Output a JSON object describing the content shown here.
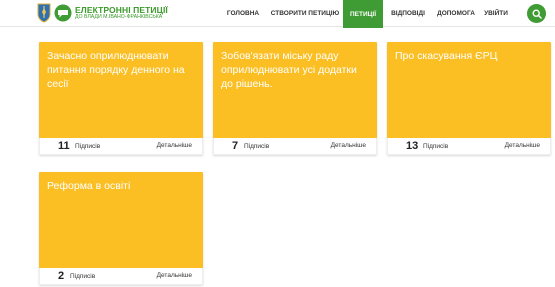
{
  "header": {
    "logo_title": "ЕЛЕКТРОННІ ПЕТИЦІЇ",
    "logo_subtitle": "ДО ВЛАДИ М.ІВАНО-ФРАНКІВСЬКА",
    "nav": [
      "ГОЛОВНА",
      "СТВОРИТИ ПЕТИЦІЮ",
      "ПЕТИЦІЇ",
      "ВІДПОВІДІ",
      "ДОПОМОГА",
      "УВІЙТИ"
    ],
    "active_nav": "ПЕТИЦІЇ",
    "search_icon": "search-icon"
  },
  "petitions": [
    {
      "title": "Зачасно оприлюднювати питання порядку денного на сесії",
      "count": "11",
      "count_label": "Підписів",
      "details": "Детальніше"
    },
    {
      "title": "Зобов'язати міську раду оприлюднювати усі додатки до рішень.",
      "count": "7",
      "count_label": "Підписів",
      "details": "Детальніше"
    },
    {
      "title": "Про скасування ЄРЦ",
      "count": "13",
      "count_label": "Підписів",
      "details": "Детальніше"
    },
    {
      "title": "Реформа в освіті",
      "count": "2",
      "count_label": "Підписів",
      "details": "Детальніше"
    }
  ],
  "colors": {
    "accent_green": "#3f9b33",
    "card_yellow": "#fbbf24"
  }
}
